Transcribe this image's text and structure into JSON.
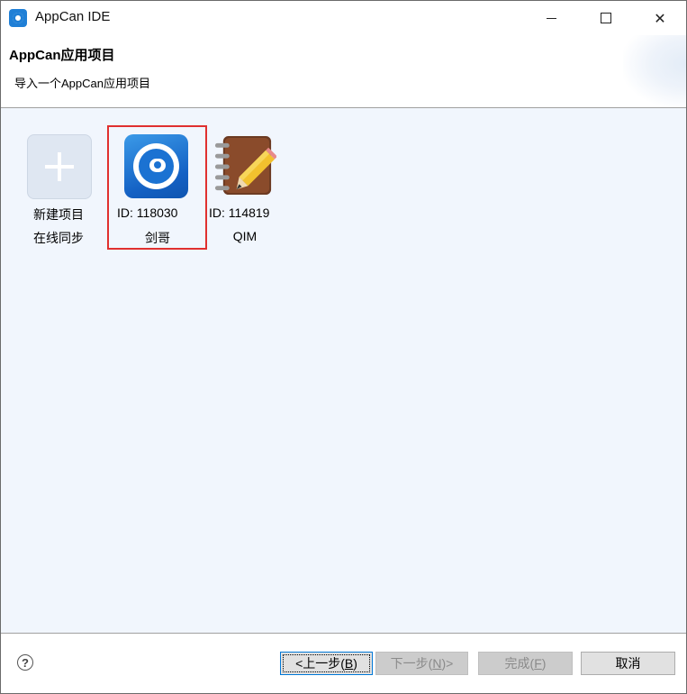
{
  "window": {
    "title": "AppCan IDE",
    "icon": "appcan-app-icon"
  },
  "banner": {
    "title": "AppCan应用项目",
    "subtitle": "导入一个AppCan应用项目"
  },
  "projects": [
    {
      "icon": "plus-icon",
      "line1": "新建项目",
      "line2": "在线同步",
      "selected": false
    },
    {
      "icon": "jiange-app-icon",
      "line1": "ID: 118030",
      "line2": "剑哥",
      "selected": true
    },
    {
      "icon": "notebook-pencil-icon",
      "line1": "ID: 114819",
      "line2": "QIM",
      "selected": false
    }
  ],
  "footer": {
    "help": "?",
    "back": {
      "text": "<上一步(",
      "key": "B",
      "end": ")"
    },
    "next": {
      "text": "下一步(",
      "key": "N",
      "end": ")>"
    },
    "finish": {
      "text": "完成(",
      "key": "F",
      "end": ")"
    },
    "cancel": "取消"
  },
  "colors": {
    "content_bg": "#f1f6fd",
    "selection_border": "#e0302f",
    "focus_border": "#0078d7"
  }
}
